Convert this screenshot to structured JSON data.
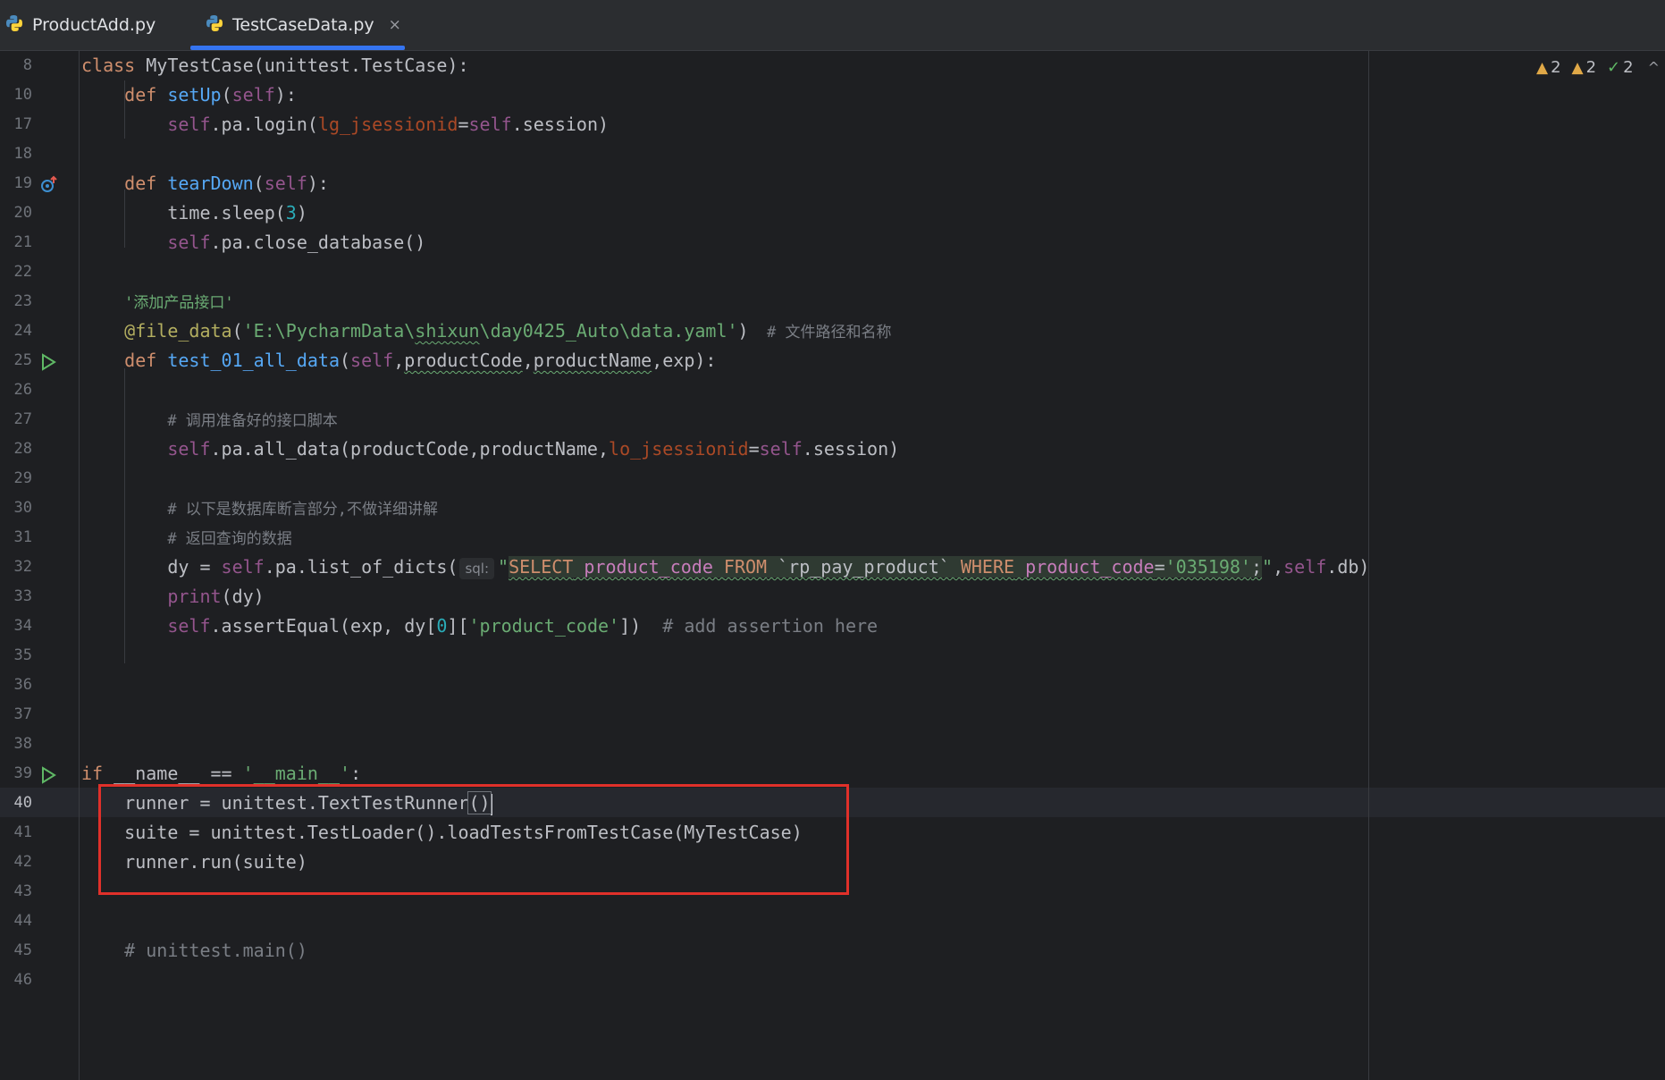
{
  "tabs": [
    {
      "label": "ProductAdd.py",
      "icon": "python-file-icon",
      "active": false
    },
    {
      "label": "TestCaseData.py",
      "icon": "python-file-icon",
      "active": true,
      "close": "×"
    }
  ],
  "inspections": {
    "warnings_a": "2",
    "warnings_b": "2",
    "ok": "2",
    "chevron": "^"
  },
  "line_numbers": [
    "8",
    "10",
    "17",
    "18",
    "19",
    "20",
    "21",
    "22",
    "23",
    "24",
    "25",
    "26",
    "27",
    "28",
    "29",
    "30",
    "31",
    "32",
    "33",
    "34",
    "35",
    "36",
    "37",
    "38",
    "39",
    "40",
    "41",
    "42",
    "43",
    "44",
    "45",
    "46"
  ],
  "code": {
    "l8": {
      "kw": "class",
      "rest": " MyTestCase(unittest.TestCase):"
    },
    "l10": {
      "kw": "def",
      "fn": "setUp",
      "self": "self",
      "tail": "):"
    },
    "l17": {
      "self": "self",
      "mid": ".pa.login(",
      "param": "lg_jsessionid",
      "eq": "=",
      "self2": "self",
      "tail": ".session)"
    },
    "l19": {
      "kw": "def",
      "fn": "tearDown",
      "self": "self",
      "tail": "):"
    },
    "l20": {
      "head": "time.sleep(",
      "num": "3",
      "tail": ")"
    },
    "l21": {
      "self": "self",
      "tail": ".pa.close_database()"
    },
    "l23": {
      "str": "'添加产品接口'"
    },
    "l24": {
      "dec": "@file_data",
      "open": "(",
      "str1": "'E:\\PycharmData\\",
      "str_typo": "shixun",
      "str2": "\\day0425_Auto\\data.yaml'",
      "close": ")",
      "comment": "  # 文件路径和名称"
    },
    "l25": {
      "kw": "def",
      "fn": "test_01_all_data",
      "self": "self",
      "p1": "productCode",
      "p2": "productName",
      "tail": ",exp):"
    },
    "l27": {
      "comment": "# 调用准备好的接口脚本"
    },
    "l28": {
      "self": "self",
      "mid": ".pa.all_data(productCode,productName,",
      "param": "lo_jsessionid",
      "eq": "=",
      "self2": "self",
      "tail": ".session)"
    },
    "l30": {
      "comment": "# 以下是数据库断言部分,不做详细讲解"
    },
    "l31": {
      "comment": "# 返回查询的数据"
    },
    "l32": {
      "head": "dy = ",
      "self": "self",
      "mid": ".pa.list_of_dicts(",
      "hint": "sql:",
      "q1": "\"",
      "sql1": "SELECT",
      "sql2": " product_code ",
      "sql3": "FROM",
      "sql4": " `rp_pay_product` ",
      "sql5": "WHERE",
      "sql6": " product_code",
      "sql7": "=",
      "sql8": "'035198'",
      "sql9": ";",
      "q2": "\"",
      "comma": ",",
      "self2": "self",
      "tail": ".db)"
    },
    "l33": {
      "fn": "print",
      "tail": "(dy)"
    },
    "l34": {
      "self": "self",
      "mid": ".assertEqual(exp, dy[",
      "num": "0",
      "mid2": "][",
      "str": "'product_code'",
      "tail": "])",
      "comment": "  # add assertion here"
    },
    "l39": {
      "kw": "if",
      "mid": " __name__ == ",
      "str": "'__main__'",
      "tail": ":"
    },
    "l40": {
      "head": "runner = unittest.TextTestRunner",
      "paren": "()"
    },
    "l41": {
      "text": "suite = unittest.TestLoader().loadTestsFromTestCase(MyTestCase)"
    },
    "l42": {
      "text": "runner.run(suite)"
    },
    "l45": {
      "comment": "# unittest.main()"
    }
  },
  "colors": {
    "background": "#1e1f22",
    "keyword": "#cf8e6d",
    "function": "#56a8f5",
    "self": "#94558d",
    "string": "#6aab73",
    "highlight_box": "#e0302a"
  }
}
